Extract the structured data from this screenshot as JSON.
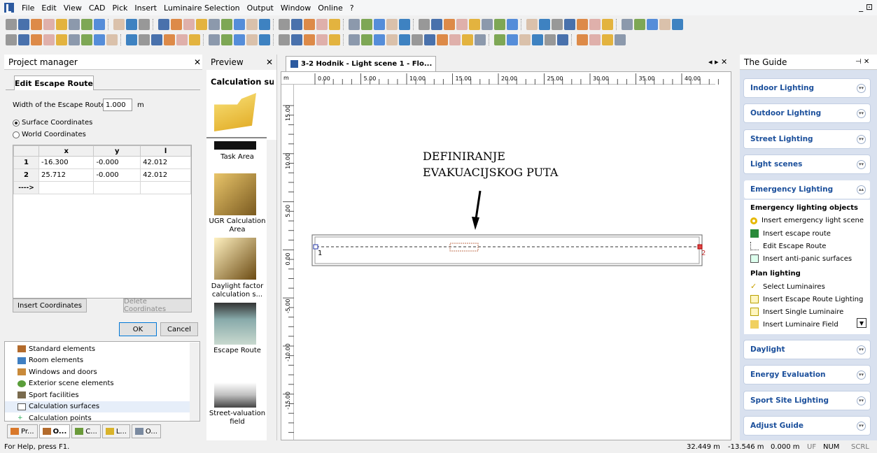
{
  "menu": {
    "items": [
      "File",
      "Edit",
      "View",
      "CAD",
      "Pick",
      "Insert",
      "Luminaire Selection",
      "Output",
      "Window",
      "Online",
      "?"
    ]
  },
  "window_controls": "_ ⊡",
  "project_manager": {
    "title": "Project manager",
    "tab": "Edit Escape Route",
    "width_label": "Width of the Escape Route:",
    "width_value": "1.000",
    "width_unit": "m",
    "radio_surface": "Surface Coordinates",
    "radio_world": "World Coordinates",
    "grid_headers": [
      "x",
      "y",
      "l"
    ],
    "rows": [
      {
        "n": "1",
        "x": "-16.300",
        "y": "-0.000",
        "l": "42.012"
      },
      {
        "n": "2",
        "x": "25.712",
        "y": "-0.000",
        "l": "42.012"
      }
    ],
    "new_row": "---->",
    "insert_btn": "Insert Coordinates",
    "delete_btn": "Delete Coordinates",
    "ok_btn": "OK",
    "cancel_btn": "Cancel",
    "tree": [
      "Standard elements",
      "Room elements",
      "Windows and doors",
      "Exterior scene elements",
      "Sport facilities",
      "Calculation surfaces",
      "Calculation points"
    ],
    "bottom_tabs": [
      "Pr...",
      "O...",
      "C...",
      "L...",
      "O..."
    ]
  },
  "preview": {
    "title": "Preview",
    "heading": "Calculation sur",
    "items": [
      "Task Area",
      "UGR Calculation Area",
      "Daylight factor calculation s...",
      "Escape Route",
      "Street-valuation field"
    ]
  },
  "drawing": {
    "tab": "3-2 Hodnik - Light scene 1 - Flo...",
    "ruler_unit": "m",
    "h_ticks": [
      "0.00",
      "5.00",
      "10.00",
      "15.00",
      "20.00",
      "25.00",
      "30.00",
      "35.00",
      "40.00"
    ],
    "v_ticks": [
      "15.00",
      "10.00",
      "5.00",
      "0.00",
      "-5.00",
      "-10.00",
      "-15.00"
    ],
    "annotation_line1": "DEFINIRANJE",
    "annotation_line2": "EVAKUACIJSKOG PUTA",
    "point1": "1",
    "point2": "2"
  },
  "guide": {
    "title": "The Guide",
    "sections": [
      "Indoor Lighting",
      "Outdoor Lighting",
      "Street Lighting",
      "Light scenes",
      "Emergency Lighting",
      "Daylight",
      "Energy Evaluation",
      "Sport Site Lighting",
      "Adjust Guide"
    ],
    "em_heading": "Emergency lighting objects",
    "em_items": [
      "Insert emergency light scene",
      "Insert escape route",
      "Edit Escape Route",
      "Insert anti-panic surfaces"
    ],
    "plan_heading": "Plan lighting",
    "plan_items": [
      "Select Luminaires",
      "Insert Escape Route Lighting",
      "Insert Single Luminaire",
      "Insert Luminaire Field"
    ]
  },
  "status": {
    "help": "For Help, press F1.",
    "x": "32.449 m",
    "y": "-13.546 m",
    "z": "0.000 m",
    "uf": "UF",
    "num": "NUM",
    "scrl": "SCRL"
  }
}
